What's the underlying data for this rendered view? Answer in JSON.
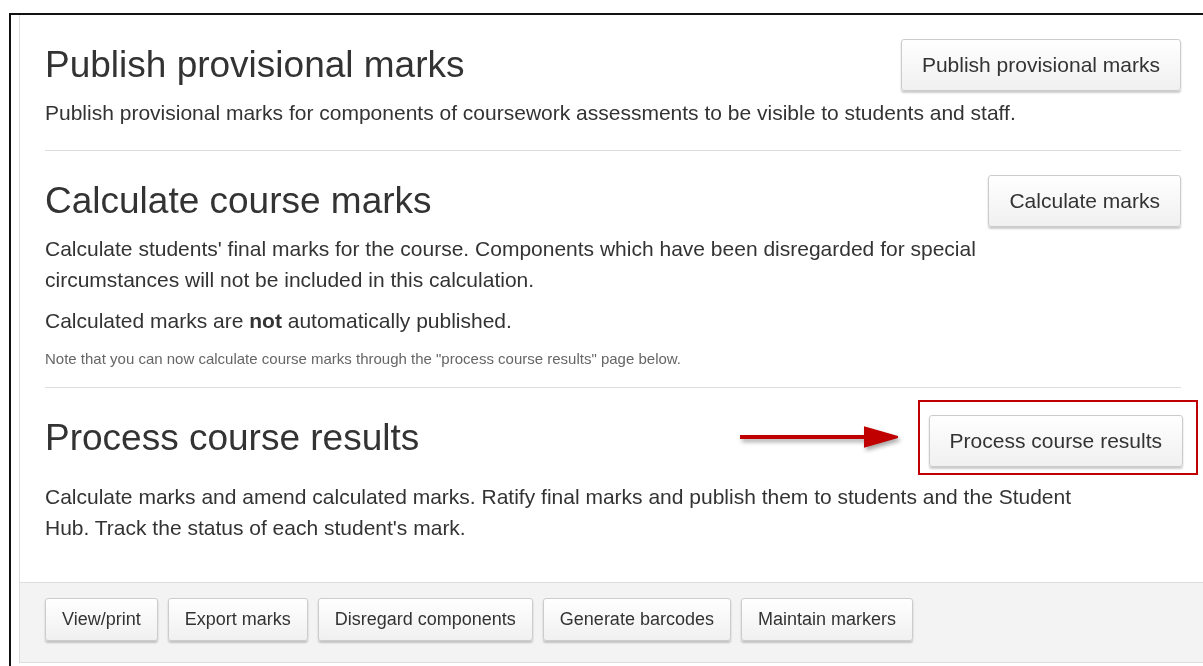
{
  "sections": [
    {
      "title": "Publish provisional marks",
      "button": "Publish provisional marks",
      "highlighted": false,
      "paragraphs": [
        "Publish provisional marks for components of coursework assessments to be visible to students and staff."
      ]
    },
    {
      "title": "Calculate course marks",
      "button": "Calculate marks",
      "highlighted": false,
      "paragraphs": [
        "Calculate students' final marks for the course. Components which have been disregarded for special circumstances will not be included in this calculation.",
        "Calculated marks are **not** automatically published."
      ],
      "note": "Note that you can now calculate course marks through the \"process course results\" page below."
    },
    {
      "title": "Process course results",
      "button": "Process course results",
      "highlighted": true,
      "paragraphs": [
        "Calculate marks and amend calculated marks. Ratify final marks and publish them to students and the Student Hub. Track the status of each student's mark."
      ]
    }
  ],
  "footer_buttons": [
    "View/print",
    "Export marks",
    "Disregard components",
    "Generate barcodes",
    "Maintain markers"
  ]
}
